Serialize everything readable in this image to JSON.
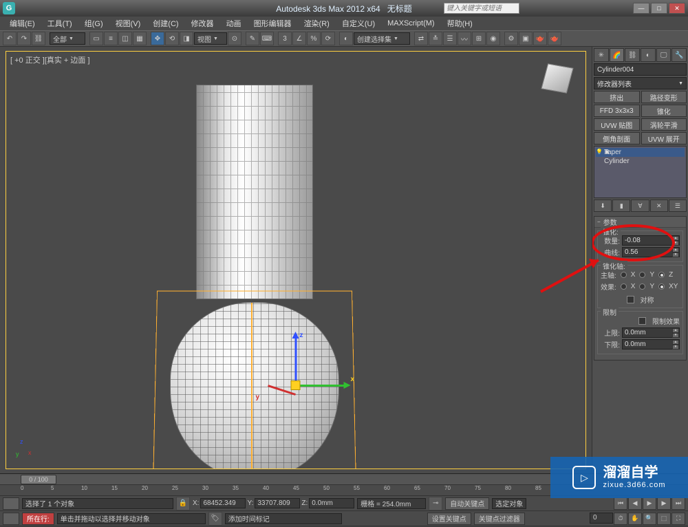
{
  "title": {
    "app": "Autodesk 3ds Max  2012  x64",
    "doc": "无标题"
  },
  "help_placeholder": "键入关键字或短语",
  "menus": [
    "编辑(E)",
    "工具(T)",
    "组(G)",
    "视图(V)",
    "创建(C)",
    "修改器",
    "动画",
    "图形编辑器",
    "渲染(R)",
    "自定义(U)",
    "MAXScript(M)",
    "帮助(H)"
  ],
  "toolbar": {
    "scope": "全部",
    "view": "视图",
    "selset": "创建选择集"
  },
  "viewport": {
    "label": "[ +0 正交 ][真实 + 边面 ]"
  },
  "cmd": {
    "object_name": "Cylinder004",
    "modlist_label": "修改器列表",
    "btns": [
      "挤出",
      "路径变形",
      "FFD 3x3x3",
      "锥化",
      "UVW 贴图",
      "涡轮平滑",
      "倒角剖面",
      "UVW 展开"
    ],
    "stack": [
      "Taper",
      "Cylinder"
    ]
  },
  "params": {
    "title": "参数",
    "taper_group": "锥化:",
    "amount_label": "数量:",
    "amount_value": "-0.08",
    "curve_label": "曲线:",
    "curve_value": "0.56",
    "axis_group": "锥化轴:",
    "primary_label": "主轴:",
    "primary_opts": [
      "X",
      "Y",
      "Z"
    ],
    "primary_sel": "Z",
    "effect_label": "效果:",
    "effect_opts": [
      "X",
      "Y",
      "XY"
    ],
    "effect_sel": "XY",
    "sym_label": "对称",
    "limit_group": "限制",
    "limit_effect": "限制效果",
    "upper_label": "上限:",
    "upper_value": "0.0mm",
    "lower_label": "下限:",
    "lower_value": "0.0mm"
  },
  "status": {
    "sel_info": "选择了 1 个对象",
    "hint": "单击并拖动以选择并移动对象",
    "now_btn": "所在行:",
    "add_time": "添加时间标记",
    "x": "68452.349",
    "y": "33707.809",
    "z": "0.0mm",
    "grid": "栅格 = 254.0mm",
    "autokey": "自动关键点",
    "selset2": "选定对象",
    "set_key": "设置关键点",
    "key_filter": "关键点过滤器",
    "frame": "0",
    "frame_label": "0 / 100"
  },
  "ruler_ticks": [
    0,
    5,
    10,
    15,
    20,
    25,
    30,
    35,
    40,
    45,
    50,
    55,
    60,
    65,
    70,
    75,
    80,
    85
  ],
  "watermark": {
    "big": "溜溜自学",
    "small": "zixue.3d66.com"
  }
}
